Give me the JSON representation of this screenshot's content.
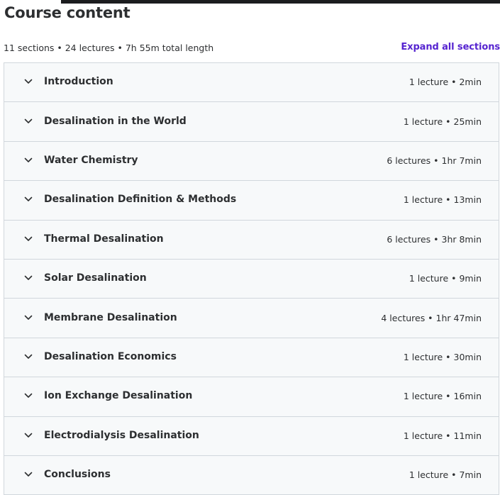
{
  "header": {
    "title": "Course content"
  },
  "summary": {
    "text": "11 sections • 24 lectures • 7h 55m total length",
    "expand_all_label": "Expand all sections"
  },
  "sections": [
    {
      "title": "Introduction",
      "meta": "1 lecture • 2min"
    },
    {
      "title": "Desalination in the World",
      "meta": "1 lecture • 25min"
    },
    {
      "title": "Water Chemistry",
      "meta": "6 lectures • 1hr 7min"
    },
    {
      "title": "Desalination Definition & Methods",
      "meta": "1 lecture • 13min"
    },
    {
      "title": "Thermal Desalination",
      "meta": "6 lectures • 3hr 8min"
    },
    {
      "title": "Solar Desalination",
      "meta": "1 lecture • 9min"
    },
    {
      "title": "Membrane Desalination",
      "meta": "4 lectures • 1hr 47min"
    },
    {
      "title": "Desalination Economics",
      "meta": "1 lecture • 30min"
    },
    {
      "title": "Ion Exchange Desalination",
      "meta": "1 lecture • 16min"
    },
    {
      "title": "Electrodialysis Desalination",
      "meta": "1 lecture • 11min"
    },
    {
      "title": "Conclusions",
      "meta": "1 lecture • 7min"
    }
  ],
  "icons": {
    "section_toggle": "chevron-down-icon"
  },
  "colors": {
    "accent": "#5624d0",
    "section_background": "#f7f9fa",
    "border": "#d1d7dc",
    "text": "#2d2f31"
  }
}
